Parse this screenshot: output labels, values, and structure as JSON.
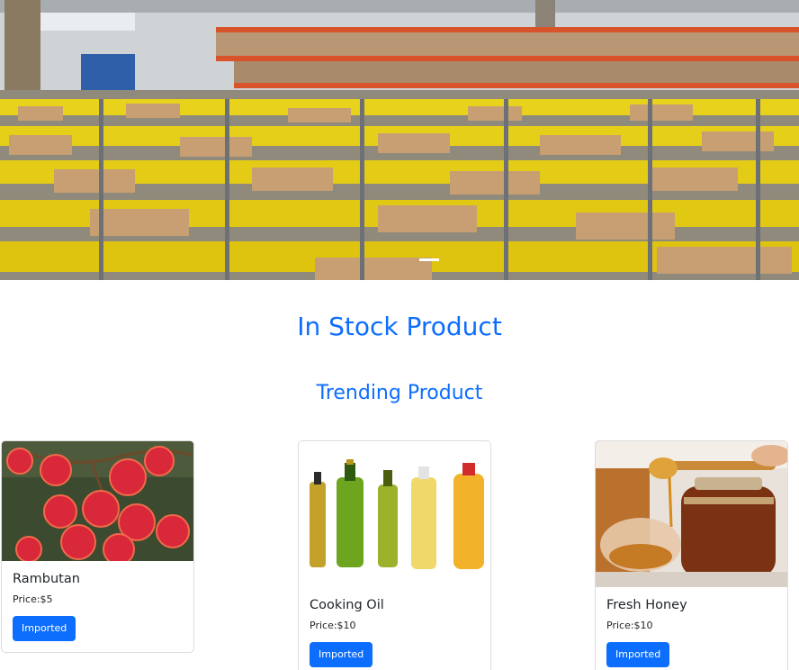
{
  "hero": {
    "image": "warehouse-photo",
    "indicator_color": "#ffffff"
  },
  "page": {
    "main_heading": "In Stock Product",
    "sub_heading": "Trending Product",
    "accent_color": "#0d6efd"
  },
  "products": [
    {
      "image": "rambutan-photo",
      "name": "Rambutan",
      "price": "Price:$5",
      "button": "Imported"
    },
    {
      "image": "cooking-oil-photo",
      "name": "Cooking Oil",
      "price": "Price:$10",
      "button": "Imported"
    },
    {
      "image": "honey-photo",
      "name": "Fresh Honey",
      "price": "Price:$10",
      "button": "Imported"
    }
  ]
}
